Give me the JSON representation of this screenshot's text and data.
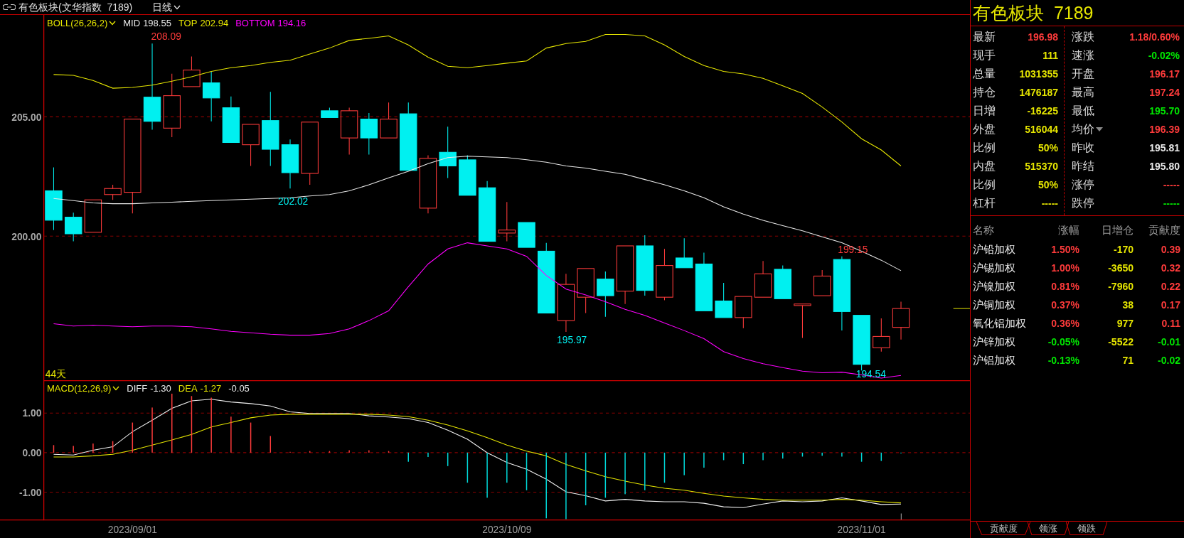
{
  "toolbar": {
    "title": "有色板块(文华指数  7189)",
    "period": "日线"
  },
  "main_chart": {
    "legend": [
      {
        "kind": "selector",
        "text": "BOLL(26,26,2)",
        "color": "#e6e600"
      },
      {
        "kind": "value",
        "text": "198.55"
      },
      {
        "kind": "value",
        "text": "202.94"
      },
      {
        "kind": "value",
        "text": "194.16"
      }
    ],
    "annotations": [
      {
        "text": "208.09",
        "kind": "high"
      },
      {
        "text": "202.02",
        "kind": "low"
      },
      {
        "text": "195.97",
        "kind": "low"
      },
      {
        "text": "199.15",
        "kind": "high"
      },
      {
        "text": "194.54",
        "kind": "low"
      }
    ],
    "days_label": "44天",
    "chart_data": {
      "type": "line",
      "grid": true,
      "ylim": [
        193.96,
        209.27
      ],
      "categories": [
        null,
        null,
        null,
        null,
        null,
        null,
        null,
        null,
        null,
        null,
        null,
        null,
        null,
        null,
        null,
        null,
        null,
        null,
        null,
        null,
        null,
        null,
        null,
        null,
        null,
        null,
        null,
        null,
        null,
        null,
        null,
        null,
        null,
        null,
        null,
        null,
        null,
        null,
        null,
        null,
        null,
        null,
        null,
        null,
        null,
        null,
        null
      ],
      "yticks": [
        {
          "value": 205,
          "label": "205.00"
        },
        {
          "value": 200,
          "label": "200.00"
        }
      ],
      "series": [
        {
          "name": "MID",
          "color": "#e8e8e8",
          "values": [
            201.58,
            201.49,
            201.39,
            201.36,
            201.36,
            201.39,
            201.42,
            201.46,
            201.49,
            201.52,
            201.55,
            201.58,
            201.61,
            201.68,
            201.74,
            201.9,
            202.15,
            202.44,
            202.72,
            203.04,
            203.29,
            203.35,
            203.32,
            203.29,
            203.2,
            203.1,
            202.94,
            202.85,
            202.72,
            202.59,
            202.37,
            202.15,
            201.9,
            201.61,
            201.23,
            200.92,
            200.66,
            200.44,
            200.22,
            199.97,
            199.72,
            199.37,
            198.99,
            198.55,
            null,
            null,
            null
          ]
        },
        {
          "name": "TOP",
          "color": "#e6e600",
          "values": [
            206.77,
            206.74,
            206.52,
            206.2,
            206.23,
            206.33,
            206.49,
            206.68,
            206.9,
            207.06,
            207.15,
            207.28,
            207.37,
            207.63,
            207.88,
            208.2,
            208.29,
            208.39,
            208.01,
            207.5,
            207.12,
            207.06,
            207.15,
            207.25,
            207.34,
            207.88,
            208.07,
            208.16,
            208.45,
            208.45,
            208.39,
            208.01,
            207.53,
            207.15,
            206.9,
            206.8,
            206.61,
            206.3,
            205.98,
            205.41,
            204.78,
            204.08,
            203.61,
            202.94,
            null,
            null,
            null
          ]
        },
        {
          "name": "BOTTOM",
          "color": "#ff00ff",
          "values": [
            196.33,
            196.23,
            196.27,
            196.23,
            196.2,
            196.23,
            196.23,
            196.2,
            196.11,
            196.01,
            195.95,
            195.89,
            195.85,
            195.85,
            195.92,
            196.11,
            196.46,
            196.87,
            197.88,
            198.83,
            199.46,
            199.72,
            199.59,
            199.46,
            199.15,
            198.35,
            197.78,
            197.53,
            197.25,
            196.93,
            196.68,
            196.36,
            196.04,
            195.7,
            195.16,
            194.87,
            194.65,
            194.49,
            194.34,
            194.27,
            194.3,
            194.18,
            194.05,
            194.16,
            null,
            null,
            null
          ]
        }
      ]
    }
  },
  "macd_chart": {
    "legend": [
      {
        "kind": "selector",
        "text": "MACD(12,26,9)",
        "color": "#e6e600"
      },
      {
        "kind": "value",
        "text": "-1.30"
      },
      {
        "kind": "value",
        "text": "-1.27"
      },
      {
        "kind": "value",
        "text": "-0.05",
        "color": "#e8e8e8"
      }
    ],
    "chart_data": {
      "type": "line",
      "grid": true,
      "ylim": [
        -1.71,
        1.83
      ],
      "categories": [
        null,
        null,
        null,
        null,
        "2023/09/01",
        null,
        null,
        null,
        null,
        null,
        null,
        null,
        null,
        null,
        null,
        null,
        null,
        null,
        null,
        null,
        null,
        null,
        null,
        "2023/10/09",
        null,
        null,
        null,
        null,
        null,
        null,
        null,
        null,
        null,
        null,
        null,
        null,
        null,
        null,
        null,
        null,
        null,
        "2023/11/01",
        null,
        null,
        null,
        null,
        null
      ],
      "yticks": [
        {
          "value": 1,
          "label": "1.00"
        },
        {
          "value": 0,
          "label": "0.00"
        },
        {
          "value": -1,
          "label": "-1.00"
        }
      ],
      "series": [
        {
          "name": "DIFF",
          "color": "#f0f0f0",
          "values": [
            -0.04,
            -0.06,
            0.06,
            0.15,
            0.53,
            0.82,
            1.12,
            1.31,
            1.35,
            1.28,
            1.24,
            1.18,
            1.03,
            0.99,
            0.99,
            0.99,
            0.93,
            0.9,
            0.86,
            0.76,
            0.57,
            0.34,
            0,
            -0.25,
            -0.42,
            -0.67,
            -0.99,
            -1.09,
            -1.22,
            -1.18,
            -1.22,
            -1.24,
            -1.24,
            -1.28,
            -1.37,
            -1.39,
            -1.3,
            -1.22,
            -1.24,
            -1.22,
            -1.14,
            -1.22,
            -1.31,
            -1.3,
            null,
            null,
            null
          ]
        },
        {
          "name": "DEA",
          "color": "#e6e600",
          "values": [
            -0.11,
            -0.11,
            -0.08,
            -0.04,
            0.06,
            0.19,
            0.32,
            0.46,
            0.65,
            0.76,
            0.88,
            0.95,
            0.97,
            0.97,
            0.97,
            0.97,
            0.97,
            0.95,
            0.91,
            0.82,
            0.7,
            0.55,
            0.38,
            0.19,
            0.04,
            -0.08,
            -0.3,
            -0.46,
            -0.61,
            -0.72,
            -0.82,
            -0.9,
            -0.95,
            -1.03,
            -1.1,
            -1.14,
            -1.18,
            -1.2,
            -1.2,
            -1.2,
            -1.18,
            -1.2,
            -1.24,
            -1.27,
            null,
            null,
            null
          ]
        },
        {
          "type": "bar",
          "color": "#ff3b3b",
          "values": [
            0.19,
            0.17,
            0.23,
            0.29,
            0.76,
            1.14,
            1.49,
            1.43,
            1.39,
            0.91,
            0.76,
            0.42,
            0.02,
            0.04,
            0.04,
            0.06,
            0.06,
            0.04,
            null,
            null,
            null,
            null,
            null,
            null,
            null,
            null,
            null,
            null,
            null,
            null,
            null,
            null,
            null,
            null,
            null,
            null,
            null,
            null,
            null,
            null,
            null,
            null,
            null,
            null,
            null,
            null,
            null
          ]
        },
        {
          "type": "bar",
          "color": "#00d8d8",
          "values": [
            null,
            null,
            null,
            null,
            null,
            null,
            null,
            null,
            null,
            null,
            null,
            null,
            null,
            null,
            null,
            null,
            null,
            null,
            -0.23,
            -0.11,
            -0.34,
            -0.76,
            -1.14,
            -0.76,
            -0.95,
            -1.66,
            -1.68,
            -1.33,
            -1.14,
            -1.05,
            -0.95,
            -0.76,
            -0.57,
            -0.38,
            -0.19,
            -0.29,
            -0.19,
            -0.15,
            -0.1,
            -0.08,
            -0.1,
            -0.23,
            -0.21,
            -0.02,
            null,
            null,
            null
          ]
        }
      ]
    }
  },
  "quote": {
    "title": "有色板块  7189",
    "left": [
      {
        "label": "最新",
        "value": "196.98",
        "color": "#ff3b3b"
      },
      {
        "label": "现手",
        "value": "111",
        "color": "#e6e600"
      },
      {
        "label": "总量",
        "value": "1031355",
        "color": "#e6e600"
      },
      {
        "label": "持仓",
        "value": "1476187",
        "color": "#e6e600"
      },
      {
        "label": "日增",
        "value": "-16225",
        "color": "#e6e600"
      },
      {
        "label": "外盘",
        "value": "516044",
        "color": "#e6e600"
      },
      {
        "label": "比例",
        "value": "50%",
        "color": "#e6e600"
      },
      {
        "label": "内盘",
        "value": "515370",
        "color": "#e6e600"
      },
      {
        "label": "比例",
        "value": "50%",
        "color": "#e6e600"
      },
      {
        "label": "杠杆",
        "value": "-----",
        "color": "#e6e600"
      }
    ],
    "right": [
      {
        "label": "涨跌",
        "value": "1.18/0.60%",
        "color": "#ff3b3b",
        "kind": "plain"
      },
      {
        "label": "速涨",
        "value": "-0.02%",
        "color": "#00e600",
        "kind": "plain"
      },
      {
        "label": "开盘",
        "value": "196.17",
        "color": "#ff3b3b",
        "kind": "plain"
      },
      {
        "label": "最高",
        "value": "197.24",
        "color": "#ff3b3b",
        "kind": "plain"
      },
      {
        "label": "最低",
        "value": "195.70",
        "color": "#00e600",
        "kind": "plain"
      },
      {
        "label": "均价",
        "value": "196.39",
        "color": "#ff3b3b",
        "kind": "dropdown"
      },
      {
        "label": "昨收",
        "value": "195.81",
        "color": "#e8e8e8",
        "kind": "plain"
      },
      {
        "label": "昨结",
        "value": "195.80",
        "color": "#e8e8e8",
        "kind": "plain"
      },
      {
        "label": "涨停",
        "value": "-----",
        "color": "#ff3b3b",
        "kind": "plain"
      },
      {
        "label": "跌停",
        "value": "-----",
        "color": "#00e600",
        "kind": "plain"
      }
    ]
  },
  "components": {
    "columns": [
      "名称",
      "涨幅",
      "日增仓",
      "贡献度"
    ],
    "rows": [
      {
        "name": "沪铅加权",
        "change": {
          "text": "1.50%",
          "color": "#ff3b3b"
        },
        "oi_change": "-170",
        "contribution": {
          "text": "0.39",
          "color": "#ff3b3b"
        }
      },
      {
        "name": "沪锡加权",
        "change": {
          "text": "1.00%",
          "color": "#ff3b3b"
        },
        "oi_change": "-3650",
        "contribution": {
          "text": "0.32",
          "color": "#ff3b3b"
        }
      },
      {
        "name": "沪镍加权",
        "change": {
          "text": "0.81%",
          "color": "#ff3b3b"
        },
        "oi_change": "-7960",
        "contribution": {
          "text": "0.22",
          "color": "#ff3b3b"
        }
      },
      {
        "name": "沪铜加权",
        "change": {
          "text": "0.37%",
          "color": "#ff3b3b"
        },
        "oi_change": "38",
        "contribution": {
          "text": "0.17",
          "color": "#ff3b3b"
        }
      },
      {
        "name": "氧化铝加权",
        "change": {
          "text": "0.36%",
          "color": "#ff3b3b"
        },
        "oi_change": "977",
        "contribution": {
          "text": "0.11",
          "color": "#ff3b3b"
        }
      },
      {
        "name": "沪锌加权",
        "change": {
          "text": "-0.05%",
          "color": "#00e600"
        },
        "oi_change": "-5522",
        "contribution": {
          "text": "-0.01",
          "color": "#00e600"
        }
      },
      {
        "name": "沪铝加权",
        "change": {
          "text": "-0.13%",
          "color": "#00e600"
        },
        "oi_change": "71",
        "contribution": {
          "text": "-0.02",
          "color": "#00e600"
        }
      }
    ]
  },
  "bottom_tabs": [
    "贡献度",
    "领涨",
    "领跌"
  ]
}
